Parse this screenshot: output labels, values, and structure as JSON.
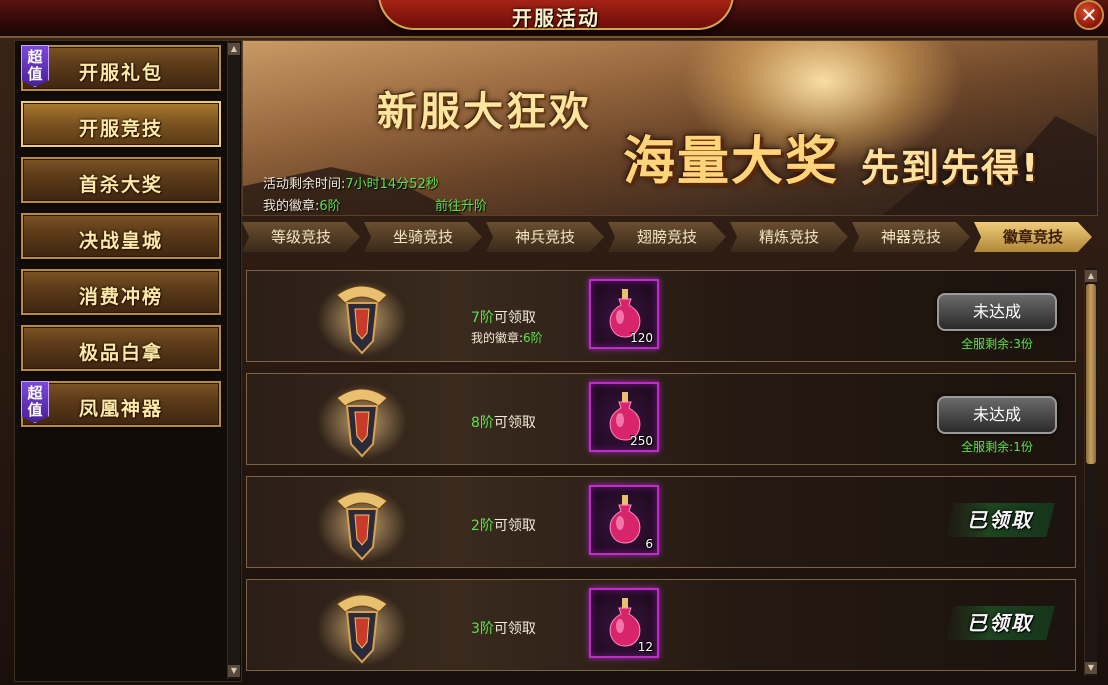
{
  "window": {
    "title": "开服活动",
    "close_symbol": "✕"
  },
  "sidebar": {
    "items": [
      {
        "label": "开服礼包",
        "tag": "超值",
        "active": false
      },
      {
        "label": "开服竞技",
        "tag": "",
        "active": true
      },
      {
        "label": "首杀大奖",
        "tag": "",
        "active": false
      },
      {
        "label": "决战皇城",
        "tag": "",
        "active": false
      },
      {
        "label": "消费冲榜",
        "tag": "",
        "active": false
      },
      {
        "label": "极品白拿",
        "tag": "",
        "active": false
      },
      {
        "label": "凤凰神器",
        "tag": "超值",
        "active": false
      }
    ],
    "scroll_up": "▲",
    "scroll_down": "▼"
  },
  "banner": {
    "title_line1": "新服大狂欢",
    "title_line2": "海量大奖",
    "title_line3": "先到先得!",
    "time_label": "活动剩余时间:",
    "time_value": "7小时14分52秒",
    "badge_label": "我的徽章:",
    "badge_value": "6阶",
    "goto_link": "前往升阶"
  },
  "tabs": [
    {
      "label": "等级竞技",
      "active": false
    },
    {
      "label": "坐骑竞技",
      "active": false
    },
    {
      "label": "神兵竞技",
      "active": false
    },
    {
      "label": "翅膀竞技",
      "active": false
    },
    {
      "label": "精炼竞技",
      "active": false
    },
    {
      "label": "神器竞技",
      "active": false
    },
    {
      "label": "徽章竞技",
      "active": true
    }
  ],
  "rewards": [
    {
      "level": "7阶",
      "suffix": "可领取",
      "my_label": "我的徽章:",
      "my_value": "6阶",
      "qty": "120",
      "status": "未达成",
      "remain_label": "全服剩余:",
      "remain_value": "3份"
    },
    {
      "level": "8阶",
      "suffix": "可领取",
      "my_label": "",
      "my_value": "",
      "qty": "250",
      "status": "未达成",
      "remain_label": "全服剩余:",
      "remain_value": "1份"
    },
    {
      "level": "2阶",
      "suffix": "可领取",
      "my_label": "",
      "my_value": "",
      "qty": "6",
      "status": "已领取",
      "remain_label": "",
      "remain_value": ""
    },
    {
      "level": "3阶",
      "suffix": "可领取",
      "my_label": "",
      "my_value": "",
      "qty": "12",
      "status": "已领取",
      "remain_label": "",
      "remain_value": ""
    }
  ],
  "colors": {
    "accent_green": "#5be14a",
    "gold": "#ffe9a8",
    "item_border": "#c02cc8"
  }
}
